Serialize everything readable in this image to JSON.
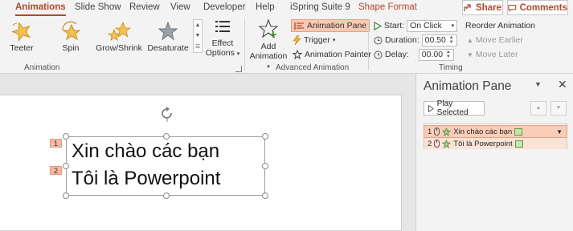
{
  "tabs": [
    "Animations",
    "Slide Show",
    "Review",
    "View",
    "Developer",
    "Help",
    "iSpring Suite 9"
  ],
  "contextual_tab": "Shape Format",
  "share_label": "Share",
  "comments_label": "Comments",
  "gallery": {
    "items": [
      "Teeter",
      "Spin",
      "Grow/Shrink",
      "Desaturate"
    ],
    "effect_options_line1": "Effect",
    "effect_options_line2": "Options",
    "group_label": "Animation"
  },
  "advanced": {
    "add_animation_line1": "Add",
    "add_animation_line2": "Animation",
    "animation_pane": "Animation Pane",
    "trigger": "Trigger",
    "animation_painter": "Animation Painter",
    "group_label": "Advanced Animation"
  },
  "timing": {
    "start_label": "Start:",
    "start_value": "On Click",
    "duration_label": "Duration:",
    "duration_value": "00.50",
    "delay_label": "Delay:",
    "delay_value": "00.00",
    "reorder_label": "Reorder Animation",
    "move_earlier": "Move Earlier",
    "move_later": "Move Later",
    "group_label": "Timing"
  },
  "slide": {
    "line1": "Xin chào các bạn",
    "line2": "Tôi là Powerpoint",
    "tag1": "1",
    "tag2": "2"
  },
  "pane": {
    "title": "Animation Pane",
    "play_selected": "Play Selected",
    "items": [
      {
        "num": "1",
        "label": "Xin chào các bạn"
      },
      {
        "num": "2",
        "label": "Tôi là Powerpoint"
      }
    ]
  },
  "colors": {
    "accent": "#b7472a",
    "selection": "#f9cdb8",
    "star_gold": "#f2c14e",
    "anim_green": "#5a9c3a"
  }
}
